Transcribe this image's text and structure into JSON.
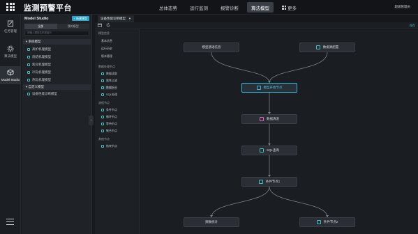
{
  "header": {
    "brand": "监测预警平台",
    "nav": [
      "总体态势",
      "运行监测",
      "报警诊断",
      "算法模型"
    ],
    "active_nav": "算法模型",
    "more": "更多",
    "user": "超级管理员"
  },
  "rail": [
    {
      "label": "任务管理",
      "icon": "task-icon"
    },
    {
      "label": "算法模型",
      "icon": "gear-icon"
    },
    {
      "label": "Model Studio",
      "icon": "cube-icon"
    }
  ],
  "panel": {
    "title": "Model Studio",
    "new_button": "+ 新建模型",
    "tabs": [
      "全部",
      "我的模型"
    ],
    "search_placeholder": "请输入模型名称或者ID",
    "groups": [
      {
        "label": "系统模型",
        "items": [
          "高炉机理模型",
          "烧结机理模型",
          "焦化机理模型",
          "冷轧机理模型",
          "热轧机理模型"
        ]
      },
      {
        "label": "自定义模型",
        "items": [
          "设备性能诊断模型"
        ]
      }
    ]
  },
  "doc_tab": {
    "label": "设备性能诊断模型"
  },
  "toolbar": {
    "right_label": "保存"
  },
  "palette": [
    {
      "head": "模型信息",
      "items": [
        "基本信息",
        "运行历史",
        "版本管理"
      ],
      "plain": true
    },
    {
      "head": "数据处理节点",
      "items": [
        "数据读取",
        "属性过滤",
        "数据拆分",
        "SQL处理"
      ]
    },
    {
      "head": "流程节点",
      "items": [
        "条件节点",
        "循环节点",
        "等待节点",
        "聚合节点"
      ]
    },
    {
      "head": "其他节点",
      "items": [
        "结束节点"
      ]
    }
  ],
  "nodes": {
    "n1": "模型基础信息",
    "n2": "数据源配置",
    "n3": "模型开始节点",
    "n4": "数据清洗",
    "n5": "SQL查询",
    "n6": "条件节点1",
    "n7": "频数统计",
    "n8": "条件节点2"
  }
}
